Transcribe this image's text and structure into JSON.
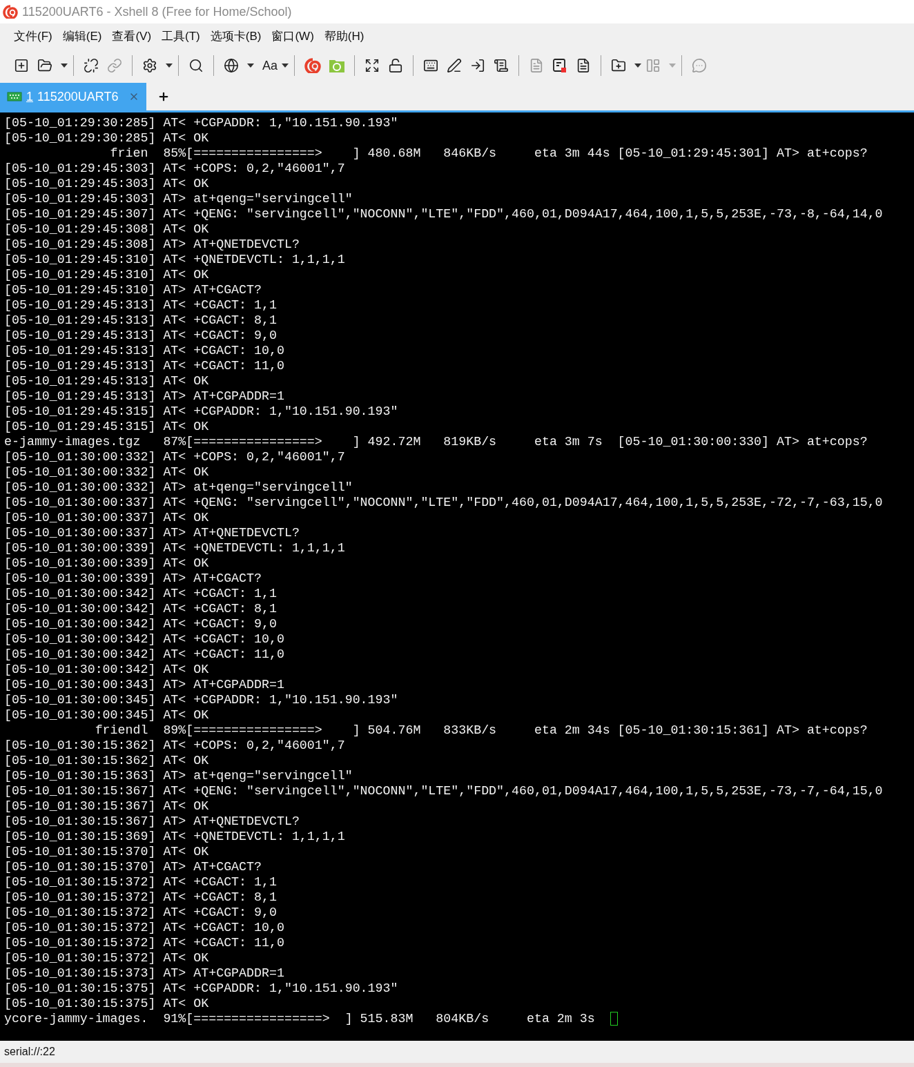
{
  "window": {
    "title": "115200UART6 - Xshell 8 (Free for Home/School)"
  },
  "menu": [
    "文件(F)",
    "编辑(E)",
    "查看(V)",
    "工具(T)",
    "选项卡(B)",
    "窗口(W)",
    "帮助(H)"
  ],
  "toolbar": {
    "font_label": "Aa"
  },
  "tabs": [
    {
      "number": "1",
      "label": "115200UART6",
      "selected": true
    }
  ],
  "terminal": {
    "lines": [
      "[05-10_01:29:30:285] AT< +CGPADDR: 1,\"10.151.90.193\"",
      "[05-10_01:29:30:285] AT< OK",
      "              frien  85%[================>    ] 480.68M   846KB/s     eta 3m 44s [05-10_01:29:45:301] AT> at+cops?",
      "[05-10_01:29:45:303] AT< +COPS: 0,2,\"46001\",7",
      "[05-10_01:29:45:303] AT< OK",
      "[05-10_01:29:45:303] AT> at+qeng=\"servingcell\"",
      "[05-10_01:29:45:307] AT< +QENG: \"servingcell\",\"NOCONN\",\"LTE\",\"FDD\",460,01,D094A17,464,100,1,5,5,253E,-73,-8,-64,14,0",
      "[05-10_01:29:45:308] AT< OK",
      "[05-10_01:29:45:308] AT> AT+QNETDEVCTL?",
      "[05-10_01:29:45:310] AT< +QNETDEVCTL: 1,1,1,1",
      "[05-10_01:29:45:310] AT< OK",
      "[05-10_01:29:45:310] AT> AT+CGACT?",
      "[05-10_01:29:45:313] AT< +CGACT: 1,1",
      "[05-10_01:29:45:313] AT< +CGACT: 8,1",
      "[05-10_01:29:45:313] AT< +CGACT: 9,0",
      "[05-10_01:29:45:313] AT< +CGACT: 10,0",
      "[05-10_01:29:45:313] AT< +CGACT: 11,0",
      "[05-10_01:29:45:313] AT< OK",
      "[05-10_01:29:45:313] AT> AT+CGPADDR=1",
      "[05-10_01:29:45:315] AT< +CGPADDR: 1,\"10.151.90.193\"",
      "[05-10_01:29:45:315] AT< OK",
      "e-jammy-images.tgz   87%[================>    ] 492.72M   819KB/s     eta 3m 7s  [05-10_01:30:00:330] AT> at+cops?",
      "[05-10_01:30:00:332] AT< +COPS: 0,2,\"46001\",7",
      "[05-10_01:30:00:332] AT< OK",
      "[05-10_01:30:00:332] AT> at+qeng=\"servingcell\"",
      "[05-10_01:30:00:337] AT< +QENG: \"servingcell\",\"NOCONN\",\"LTE\",\"FDD\",460,01,D094A17,464,100,1,5,5,253E,-72,-7,-63,15,0",
      "[05-10_01:30:00:337] AT< OK",
      "[05-10_01:30:00:337] AT> AT+QNETDEVCTL?",
      "[05-10_01:30:00:339] AT< +QNETDEVCTL: 1,1,1,1",
      "[05-10_01:30:00:339] AT< OK",
      "[05-10_01:30:00:339] AT> AT+CGACT?",
      "[05-10_01:30:00:342] AT< +CGACT: 1,1",
      "[05-10_01:30:00:342] AT< +CGACT: 8,1",
      "[05-10_01:30:00:342] AT< +CGACT: 9,0",
      "[05-10_01:30:00:342] AT< +CGACT: 10,0",
      "[05-10_01:30:00:342] AT< +CGACT: 11,0",
      "[05-10_01:30:00:342] AT< OK",
      "[05-10_01:30:00:343] AT> AT+CGPADDR=1",
      "[05-10_01:30:00:345] AT< +CGPADDR: 1,\"10.151.90.193\"",
      "[05-10_01:30:00:345] AT< OK",
      "            friendl  89%[================>    ] 504.76M   833KB/s     eta 2m 34s [05-10_01:30:15:361] AT> at+cops?",
      "[05-10_01:30:15:362] AT< +COPS: 0,2,\"46001\",7",
      "[05-10_01:30:15:362] AT< OK",
      "[05-10_01:30:15:363] AT> at+qeng=\"servingcell\"",
      "[05-10_01:30:15:367] AT< +QENG: \"servingcell\",\"NOCONN\",\"LTE\",\"FDD\",460,01,D094A17,464,100,1,5,5,253E,-73,-7,-64,15,0",
      "[05-10_01:30:15:367] AT< OK",
      "[05-10_01:30:15:367] AT> AT+QNETDEVCTL?",
      "[05-10_01:30:15:369] AT< +QNETDEVCTL: 1,1,1,1",
      "[05-10_01:30:15:370] AT< OK",
      "[05-10_01:30:15:370] AT> AT+CGACT?",
      "[05-10_01:30:15:372] AT< +CGACT: 1,1",
      "[05-10_01:30:15:372] AT< +CGACT: 8,1",
      "[05-10_01:30:15:372] AT< +CGACT: 9,0",
      "[05-10_01:30:15:372] AT< +CGACT: 10,0",
      "[05-10_01:30:15:372] AT< +CGACT: 11,0",
      "[05-10_01:30:15:372] AT< OK",
      "[05-10_01:30:15:373] AT> AT+CGPADDR=1",
      "[05-10_01:30:15:375] AT< +CGPADDR: 1,\"10.151.90.193\"",
      "[05-10_01:30:15:375] AT< OK",
      "ycore-jammy-images.  91%[=================>  ] 515.83M   804KB/s     eta 2m 3s  "
    ]
  },
  "status_bar": {
    "text": "serial://:22"
  }
}
